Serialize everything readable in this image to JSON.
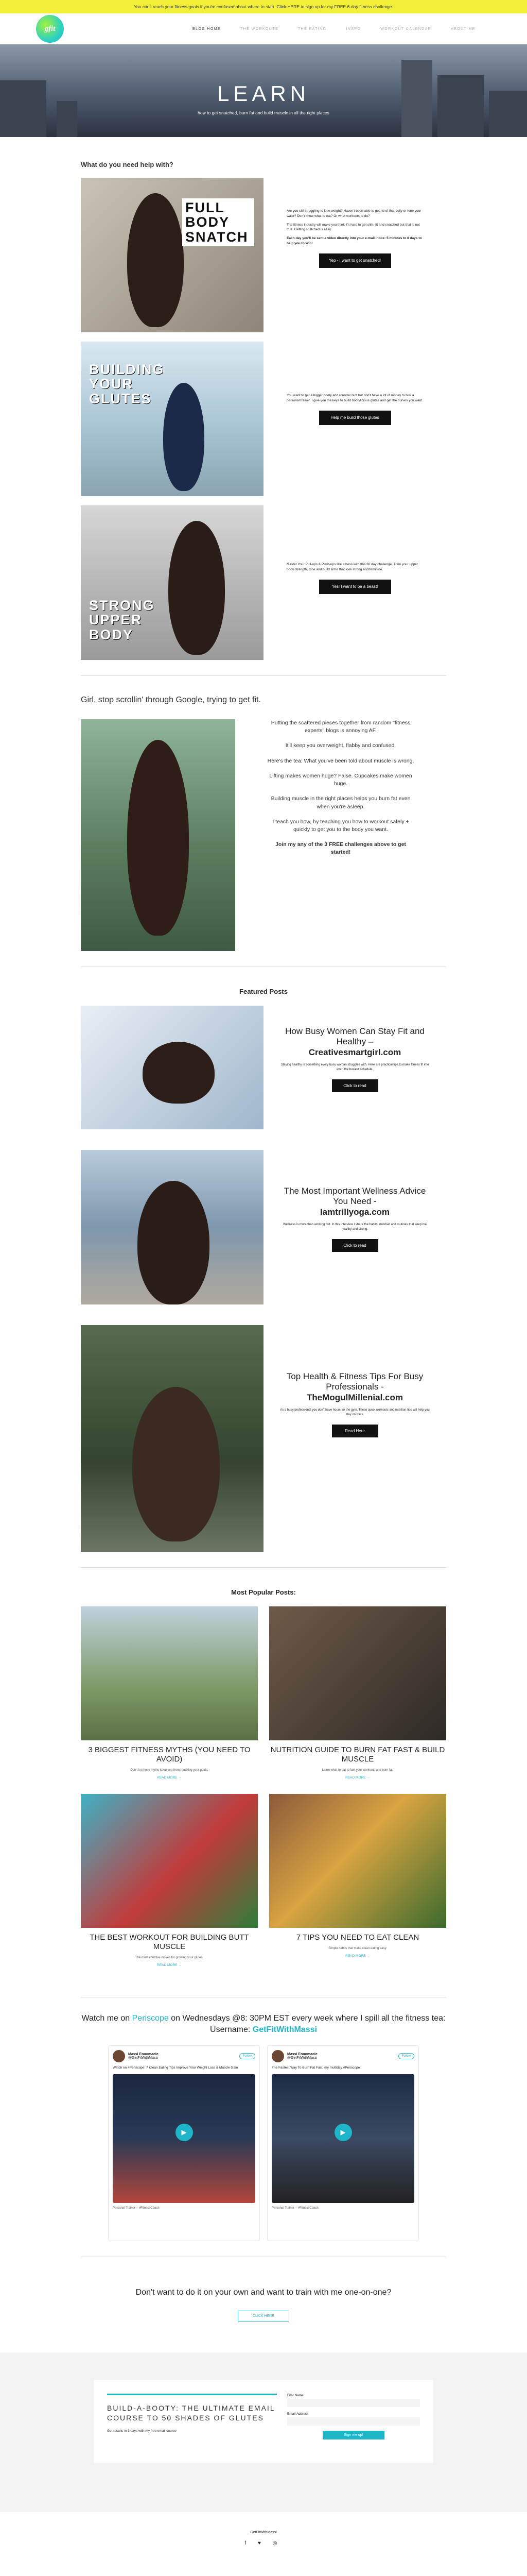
{
  "banner": {
    "text": "You can't reach your fitness goals if you're confused about where to start. Click HERE to sign up for my FREE 6-day fitness challenge."
  },
  "nav": {
    "logo": "gfit",
    "items": [
      "BLOG HOME",
      "THE WORKOUTS",
      "THE EATING",
      "INSPO",
      "WORKOUT CALENDAR",
      "ABOUT ME"
    ]
  },
  "hero": {
    "title": "LEARN",
    "subtitle": "how to get snatched, burn fat and build muscle in all the right places"
  },
  "help": {
    "heading": "What do you need help with?",
    "rows": [
      {
        "overlay": "FULL BODY SNATCH",
        "p1": "Are you still struggling to lose weight? Haven't been able to get rid of that belly or tone your waist? Don't know what to eat? Or what workouts to do?",
        "p2": "The fitness industry will make you think it's hard to get slim, fit and snatched but that is not true. Getting snatched is easy.",
        "p3": "Each day you'll be sent a video directly into your e-mail inbox: 5 minutes to 8 days to help you to Win!",
        "btn": "Yep - I want to get snatched!"
      },
      {
        "overlay": "BUILDING YOUR GLUTES",
        "p1": "You want to get a bigger booty and rounder butt but don't have a lot of money to hire a personal trainer. I give you the keys to build bootylicious glutes and get the curves you want.",
        "p2": "",
        "p3": "",
        "btn": "Help me build those glutes"
      },
      {
        "overlay": "STRONG UPPER BODY",
        "p1": "Master Your Pull-ups & Push-ups like a boss with this 30 day challenge. Train your upper body strength, tone and build arms that look strong and feminine.",
        "p2": "",
        "p3": "",
        "btn": "Yes! I want to be a beast!"
      }
    ]
  },
  "google": {
    "heading": "Girl, stop scrollin' through Google, trying to get fit.",
    "paras": [
      "Putting the scattered pieces together from random \"fitness experts\" blogs is annoying AF.",
      "It'll keep you overweight, flabby and confused.",
      "Here's the tea: What you've been told about muscle is wrong.",
      "Lifting makes women huge? False. Cupcakes make women huge.",
      "Building muscle in the right places helps you burn fat even when you're asleep.",
      "I teach you how, by teaching you how to workout safely + quickly to get you to the body you want.",
      "Join my any of the 3 FREE challenges above to get started!"
    ]
  },
  "featured": {
    "heading": "Featured Posts",
    "posts": [
      {
        "title": "How Busy Women Can Stay Fit and Healthy –",
        "site": "Creativesmartgirl.com",
        "text": "Staying healthy is something every busy woman struggles with. Here are practical tips to make fitness fit into even the busiest schedule.",
        "btn": "Click to read"
      },
      {
        "title": "The Most Important Wellness Advice You Need -",
        "site": "Iamtrillyoga.com",
        "text": "Wellness is more than working out. In this interview I share the habits, mindset and routines that keep me healthy and strong.",
        "btn": "Click to read"
      },
      {
        "title": "Top Health & Fitness Tips For Busy Professionals -",
        "site": "TheMogulMillenial.com",
        "text": "As a busy professional you don't have hours for the gym. These quick workouts and nutrition tips will help you stay on track.",
        "btn": "Read Here"
      }
    ]
  },
  "popular": {
    "heading": "Most Popular Posts:",
    "posts": [
      {
        "title": "3 BIGGEST FITNESS MYTHS (YOU NEED TO AVOID)",
        "text": "Don't let these myths keep you from reaching your goals.",
        "link": "READ MORE →"
      },
      {
        "title": "NUTRITION GUIDE TO BURN FAT FAST & BUILD MUSCLE",
        "text": "Learn what to eat to fuel your workouts and burn fat.",
        "link": "READ MORE →"
      },
      {
        "title": "THE BEST WORKOUT FOR BUILDING BUTT MUSCLE",
        "text": "The most effective moves for growing your glutes.",
        "link": "READ MORE →"
      },
      {
        "title": "7 TIPS YOU NEED TO EAT CLEAN",
        "text": "Simple habits that make clean eating easy.",
        "link": "READ MORE →"
      }
    ]
  },
  "periscope": {
    "pre": "Watch me on ",
    "app": "Periscope",
    "mid": " on Wednesdays @8: 30PM EST every week where I spill all the fitness tea: Username: ",
    "user": "GetFitWithMassi"
  },
  "tweets": [
    {
      "name": "Massi Enuomacie",
      "handle": "@GetFitWithMassi",
      "follow": "Follow",
      "text": "Watch on #Periscope: 7 Clean Eating Tips Improve Your Weight Loss & Muscle Gain",
      "foot": "Personal Trainer – #FitnessCoach"
    },
    {
      "name": "Massi Enuomacie",
      "handle": "@GetFitWithMassi",
      "follow": "Follow",
      "text": "The Fastest Way To Burn Fat Fast: my multiday #Periscope",
      "foot": "Personal Trainer – #FitnessCoach"
    }
  ],
  "coaching": {
    "text": "Don't want to do it on your own and want to train with me one-on-one?",
    "btn": "CLICK HERE"
  },
  "signup": {
    "title": "BUILD-A-BOOTY: THE ULTIMATE EMAIL COURSE TO 50 SHADES OF GLUTES",
    "sub": "Get results in 3 days with my free email course",
    "name": "First Name",
    "email": "Email Address",
    "btn": "Sign me up!"
  },
  "footer": {
    "brand": "GetFitWithMassi",
    "social": "f ♥ ◎"
  }
}
